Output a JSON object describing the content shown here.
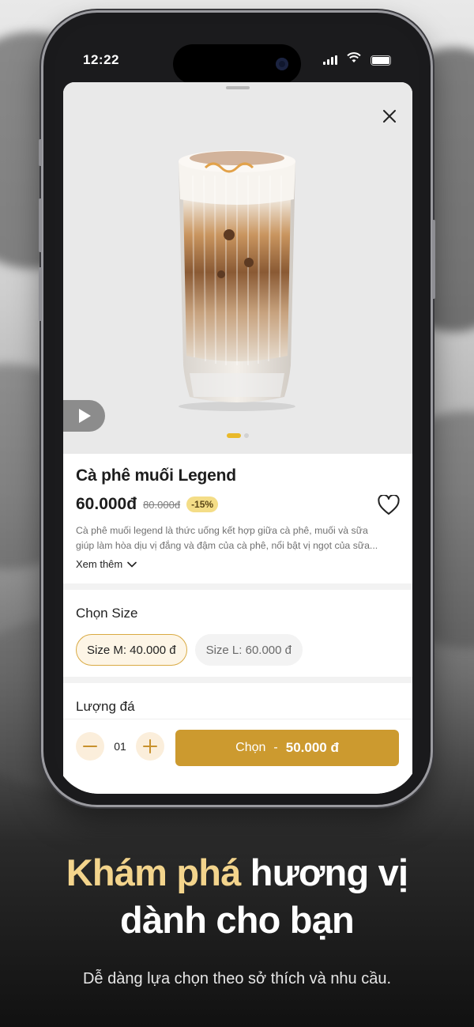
{
  "status_bar": {
    "time": "12:22"
  },
  "product": {
    "name": "Cà phê muối Legend",
    "price": "60.000đ",
    "old_price": "80.000đ",
    "discount": "-15%",
    "description_line1": "Cà phê muối legend là thức uống kết hợp giữa cà phê, muối và sữa",
    "description_line2": "giúp làm hòa dịu vị đắng và đậm của cà phê, nổi bật vị ngọt của sữa...",
    "see_more": "Xem thêm",
    "image_index": 1,
    "image_count": 2
  },
  "size_section": {
    "title": "Chọn Size",
    "options": [
      "Size M: 40.000 đ",
      "Size L: 60.000 đ"
    ],
    "selected": "Size M: 40.000 đ"
  },
  "ice_section": {
    "title": "Lượng đá"
  },
  "order_bar": {
    "quantity": "01",
    "button_label": "Chọn",
    "separator": "-",
    "button_amount": "50.000 đ"
  },
  "marketing": {
    "headline_highlight": "Khám phá",
    "headline_rest1": " hương vị",
    "headline_line2": "dành cho bạn",
    "subtitle": "Dễ dàng lựa chọn theo sở thích và nhu cầu."
  },
  "colors": {
    "accent_gold": "#cc9a2f",
    "headline_gold": "#f3d48c",
    "discount_bg": "#f4dd87",
    "dot_active": "#e9b92a"
  },
  "icons": [
    "close-icon",
    "play-icon",
    "heart-icon",
    "chevron-down-icon",
    "minus-icon",
    "plus-icon",
    "wifi-icon",
    "battery-icon",
    "signal-icon"
  ]
}
